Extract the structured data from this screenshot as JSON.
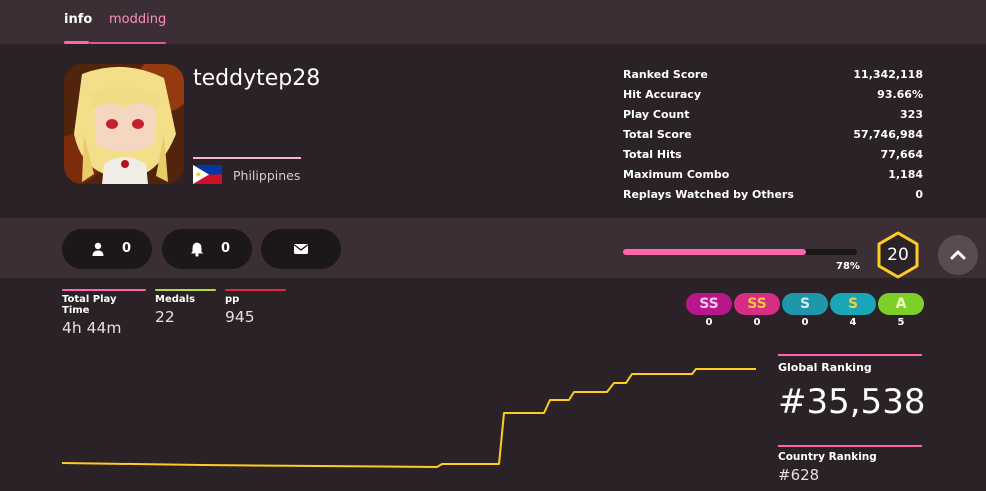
{
  "tabs": [
    {
      "label": "info",
      "active": true
    },
    {
      "label": "modding",
      "active": false
    }
  ],
  "profile": {
    "username": "teddytep28",
    "country": "Philippines",
    "avatar": "anime-avatar"
  },
  "stats": [
    {
      "label": "Ranked Score",
      "value": "11,342,118"
    },
    {
      "label": "Hit Accuracy",
      "value": "93.66%"
    },
    {
      "label": "Play Count",
      "value": "323"
    },
    {
      "label": "Total Score",
      "value": "57,746,984"
    },
    {
      "label": "Total Hits",
      "value": "77,664"
    },
    {
      "label": "Maximum Combo",
      "value": "1,184"
    },
    {
      "label": "Replays Watched by Others",
      "value": "0"
    }
  ],
  "actions": {
    "followers": {
      "icon": "user-icon",
      "count": "0"
    },
    "mapping_subscribers": {
      "icon": "bell-icon",
      "count": "0"
    },
    "message": {
      "icon": "mail-icon"
    },
    "collapse": {
      "icon": "chevron-up-icon"
    }
  },
  "level": {
    "number": "20",
    "progress_percent": 78,
    "progress_label": "78%"
  },
  "summary": [
    {
      "label": "Total Play Time",
      "value": "4h 44m",
      "color": "#ff66aa"
    },
    {
      "label": "Medals",
      "value": "22",
      "color": "#b3d944"
    },
    {
      "label": "pp",
      "value": "945",
      "color": "#e0263b"
    }
  ],
  "grades": [
    {
      "label": "SS",
      "count": "0",
      "bg": "#b8178c",
      "fg": "#f5c9e8"
    },
    {
      "label": "SS",
      "count": "0",
      "bg": "#d62d86",
      "fg": "#f0c83a"
    },
    {
      "label": "S",
      "count": "0",
      "bg": "#1f96a9",
      "fg": "#cdeef4"
    },
    {
      "label": "S",
      "count": "4",
      "bg": "#1aa6b6",
      "fg": "#f0d040"
    },
    {
      "label": "A",
      "count": "5",
      "bg": "#7fcf2a",
      "fg": "#eaffc0"
    }
  ],
  "ranking": {
    "global_label": "Global Ranking",
    "global_value": "#35,538",
    "country_label": "Country Ranking",
    "country_value": "#628"
  },
  "colors": {
    "accent": "#ff66aa",
    "level_ring": "#ffcc22",
    "rank_history_line": "#ffcc22"
  }
}
